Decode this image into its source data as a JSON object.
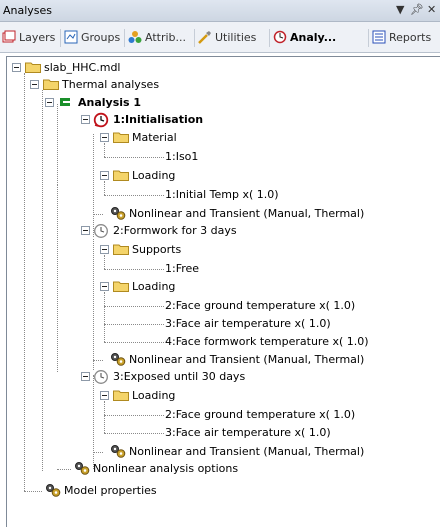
{
  "titlebar": {
    "title": "Analyses",
    "pin_glyph": "▼ &#x2002;",
    "close_glyph": "✕"
  },
  "tabs": [
    {
      "label": "Layers",
      "icon": "layers-icon"
    },
    {
      "label": "Groups",
      "icon": "groups-icon"
    },
    {
      "label": "Attrib...",
      "icon": "attributes-icon"
    },
    {
      "label": "Utilities",
      "icon": "utilities-icon"
    },
    {
      "label": "Analy...",
      "icon": "analyses-icon",
      "active": true
    },
    {
      "label": "Reports",
      "icon": "reports-icon"
    }
  ],
  "tree": {
    "model": "slab_HHC.mdl",
    "thermal": "Thermal analyses",
    "analysis1": "Analysis 1",
    "stage1": {
      "label": "1:Initialisation",
      "material": "Material",
      "material_item": "1:Iso1",
      "loading": "Loading",
      "loading_item": "1:Initial Temp x( 1.0)",
      "control": "Nonlinear and Transient (Manual, Thermal)"
    },
    "stage2": {
      "label": "2:Formwork for 3 days",
      "supports": "Supports",
      "supports_item": "1:Free",
      "loading": "Loading",
      "loading_items": [
        "2:Face ground temperature x( 1.0)",
        "3:Face air temperature x( 1.0)",
        "4:Face formwork temperature x( 1.0)"
      ],
      "control": "Nonlinear and Transient (Manual, Thermal)"
    },
    "stage3": {
      "label": "3:Exposed until 30 days",
      "loading": "Loading",
      "loading_items": [
        "2:Face ground temperature x( 1.0)",
        "3:Face air temperature x( 1.0)"
      ],
      "control": "Nonlinear and Transient (Manual, Thermal)"
    },
    "nl_options": "Nonlinear analysis options",
    "model_props": "Model properties"
  }
}
